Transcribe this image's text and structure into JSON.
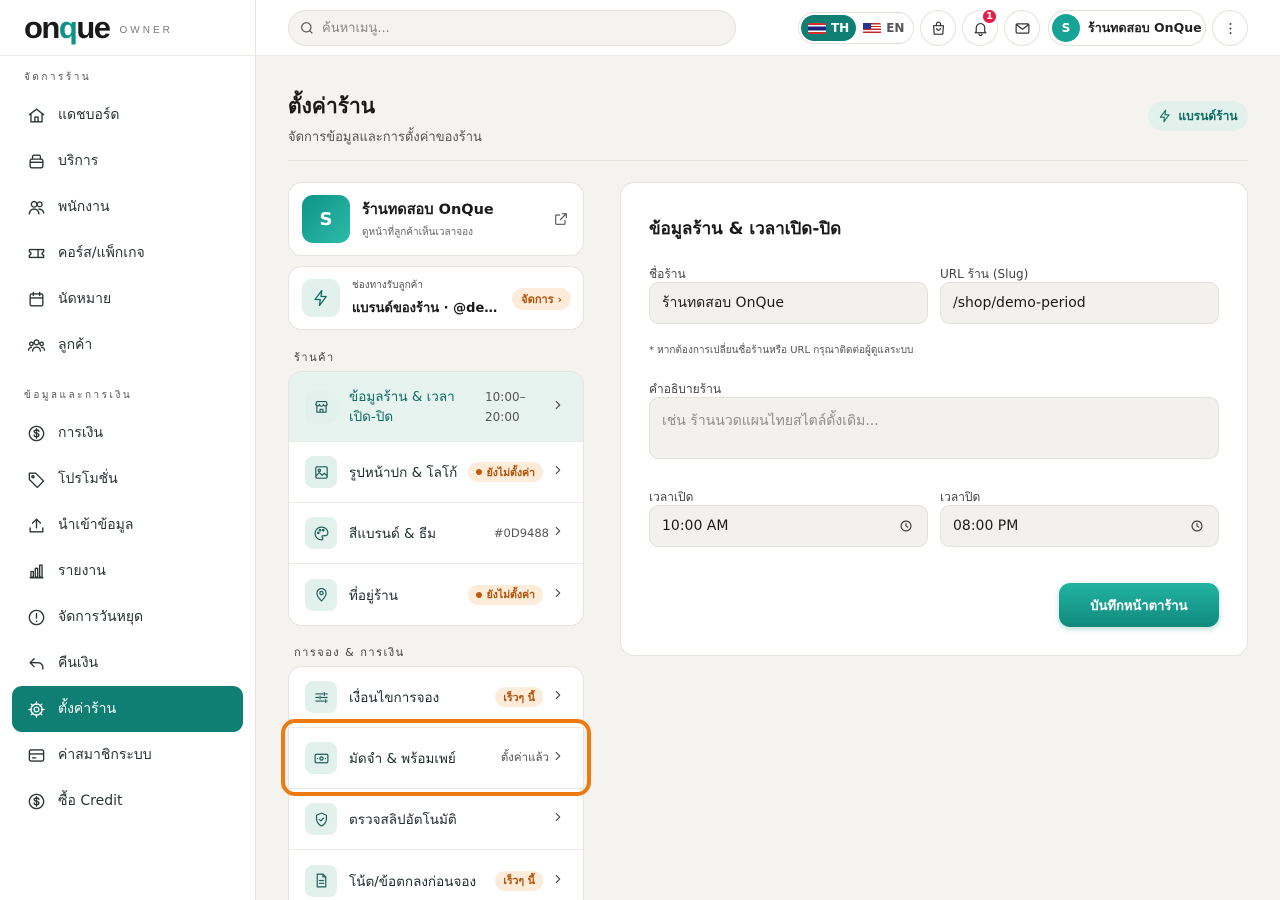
{
  "brand": {
    "logo_pre": "on",
    "logo_q": "q",
    "logo_post": "ue",
    "logo_sub": "OWNER"
  },
  "sidebar": {
    "section_store": "จัดการร้าน",
    "section_finance": "ข้อมูลและการเงิน",
    "items": [
      {
        "label": "แดชบอร์ด",
        "icon": "home-icon"
      },
      {
        "label": "บริการ",
        "icon": "service-icon"
      },
      {
        "label": "พนักงาน",
        "icon": "staff-icon"
      },
      {
        "label": "คอร์ส/แพ็กเกจ",
        "icon": "ticket-icon"
      },
      {
        "label": "นัดหมาย",
        "icon": "calendar-icon"
      },
      {
        "label": "ลูกค้า",
        "icon": "customers-icon"
      },
      {
        "label": "การเงิน",
        "icon": "dollar-icon"
      },
      {
        "label": "โปรโมชั่น",
        "icon": "tag-icon"
      },
      {
        "label": "นำเข้าข้อมูล",
        "icon": "upload-icon"
      },
      {
        "label": "รายงาน",
        "icon": "chart-icon"
      },
      {
        "label": "จัดการวันหยุด",
        "icon": "alert-icon"
      },
      {
        "label": "คืนเงิน",
        "icon": "refund-icon"
      },
      {
        "label": "ตั้งค่าร้าน",
        "icon": "gear-icon"
      },
      {
        "label": "ค่าสมาชิกระบบ",
        "icon": "card-icon"
      },
      {
        "label": "ซื้อ Credit",
        "icon": "dollar-icon"
      }
    ]
  },
  "topbar": {
    "search_placeholder": "ค้นหาเมนู...",
    "lang_th": "TH",
    "lang_en": "EN",
    "notification_count": "1",
    "profile_initial": "S",
    "profile_name": "ร้านทดสอบ OnQue"
  },
  "header": {
    "title": "ตั้งค่าร้าน",
    "subtitle": "จัดการข้อมูลและการตั้งค่าของร้าน",
    "brand_button": "แบรนด์ร้าน"
  },
  "store_card": {
    "initial": "S",
    "name": "ร้านทดสอบ OnQue",
    "sub": "ดูหน้าที่ลูกค้าเห็นเวลาจอง"
  },
  "channel_card": {
    "label": "ช่องทางรับลูกค้า",
    "value": "แบรนด์ของร้าน · @demo-period",
    "manage": "จัดการ ›"
  },
  "sections": {
    "store": "ร้านค้า",
    "booking": "การจอง & การเงิน"
  },
  "store_rows": [
    {
      "label": "ข้อมูลร้าน & เวลาเปิด-ปิด",
      "time_from": "10:00–",
      "time_to": "20:00"
    },
    {
      "label": "รูปหน้าปก & โลโก้",
      "tag": "ยังไม่ตั้งค่า"
    },
    {
      "label": "สีแบรนด์ & ธีม",
      "right": "#0D9488"
    },
    {
      "label": "ที่อยู่ร้าน",
      "tag": "ยังไม่ตั้งค่า"
    }
  ],
  "booking_rows": [
    {
      "label": "เงื่อนไขการจอง",
      "tag": "เร็วๆ นี้"
    },
    {
      "label": "มัดจำ & พร้อมเพย์",
      "right": "ตั้งค่าแล้ว"
    },
    {
      "label": "ตรวจสลิปอัตโนมัติ"
    },
    {
      "label": "โน้ต/ข้อตกลงก่อนจอง",
      "tag": "เร็วๆ นี้"
    }
  ],
  "form": {
    "title": "ข้อมูลร้าน & เวลาเปิด-ปิด",
    "name_label": "ชื่อร้าน",
    "name_value": "ร้านทดสอบ OnQue",
    "slug_label": "URL ร้าน (Slug)",
    "slug_value": "/shop/demo-period",
    "hint": "* หากต้องการเปลี่ยนชื่อร้านหรือ URL กรุณาติดต่อผู้ดูแลระบบ",
    "desc_label": "คำอธิบายร้าน",
    "desc_placeholder": "เช่น ร้านนวดแผนไทยสไตล์ดั้งเดิม...",
    "open_label": "เวลาเปิด",
    "open_value": "10:00 AM",
    "close_label": "เวลาปิด",
    "close_value": "08:00 PM",
    "save": "บันทึกหน้าตาร้าน"
  },
  "colors": {
    "accent": "#0F7F74",
    "brand": "#0D9488",
    "warn": "#B45309",
    "highlight": "#F07A12"
  }
}
